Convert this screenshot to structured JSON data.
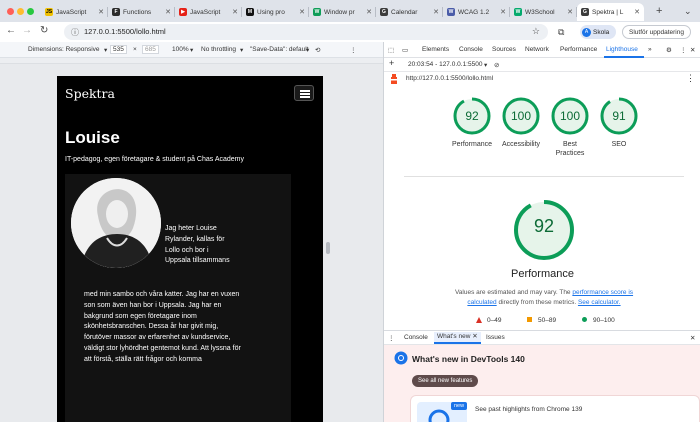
{
  "tabs": [
    {
      "label": "JavaScript",
      "favicon": "JS",
      "color": "#f0c000"
    },
    {
      "label": "Functions",
      "favicon": "F",
      "color": "#2b2b2b"
    },
    {
      "label": "JavaScript",
      "favicon": "▶",
      "color": "#e62117"
    },
    {
      "label": "Using pro",
      "favicon": "M",
      "color": "#111111"
    },
    {
      "label": "Window pr",
      "favicon": "W",
      "color": "#0f9d58"
    },
    {
      "label": "Calendar",
      "favicon": "G",
      "color": "#3c3c3c"
    },
    {
      "label": "WCAG 1.2",
      "favicon": "W",
      "color": "#4a5ca8"
    },
    {
      "label": "W3School",
      "favicon": "W",
      "color": "#04aa6d"
    },
    {
      "label": "Spektra | L",
      "favicon": "G",
      "color": "#3c3c3c",
      "active": true
    }
  ],
  "toolbar": {
    "url": "127.0.0.1:5500/lollo.html",
    "profile_label": "Skola",
    "profile_initial": "A",
    "update_label": "Slutför uppdatering"
  },
  "device_bar": {
    "dimensions": "Dimensions: Responsive",
    "width": "535",
    "height": "685",
    "zoom": "100%",
    "throttle": "No throttling",
    "save_data": "\"Save-Data\": default"
  },
  "site": {
    "brand": "Spektra",
    "heading": "Louise",
    "subtitle": "IT-pedagog, egen företagare & student på Chas Academy",
    "bio_side": "Jag heter Louise Rylander, kallas för Lollo och bor i Uppsala tillsammans",
    "bio_body": "med min sambo och våra katter. Jag har en vuxen son som även han bor i Uppsala. Jag har en bakgrund som egen företagare inom skönhetsbranschen. Dessa år har givit mig, förutöver massor av erfarenhet av kundservice, väldigt stor lyhördhet gentemot kund. Att lyssna för att förstå, ställa rätt frågor och komma"
  },
  "devtools": {
    "tabs": [
      "Elements",
      "Console",
      "Sources",
      "Network",
      "Performance",
      "Lighthouse"
    ],
    "active_tab": "Lighthouse",
    "report_label": "20:03:54 - 127.0.0.1:5500",
    "report_url": "http://127.0.0.1:5500/lollo.html",
    "scores": [
      {
        "name": "Performance",
        "value": 92
      },
      {
        "name": "Accessibility",
        "value": 100
      },
      {
        "name": "Best Practices",
        "value": 100
      },
      {
        "name": "SEO",
        "value": 91
      }
    ],
    "main_score": 92,
    "main_title": "Performance",
    "note_prefix": "Values are estimated and may vary. The ",
    "note_link1": "performance score is calculated",
    "note_mid": " directly from these metrics. ",
    "note_link2": "See calculator.",
    "legend": [
      "0–49",
      "50–89",
      "90–100"
    ],
    "score_color": "#0c9d58",
    "score_bg": "#e6f4ea"
  },
  "drawer": {
    "tabs": [
      "Console",
      "What's new",
      "Issues"
    ],
    "title": "What's new in DevTools 140",
    "see_all": "See all new features",
    "promo_badge": "new",
    "promo_text": "See past highlights from Chrome 139"
  }
}
